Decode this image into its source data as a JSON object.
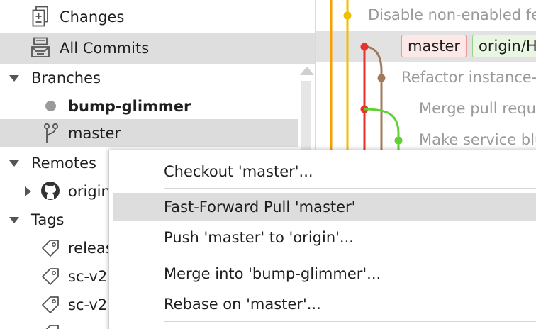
{
  "sidebar": {
    "workspace": [
      {
        "label": "Changes",
        "icon": "changes-icon"
      },
      {
        "label": "All Commits",
        "icon": "commits-icon",
        "selected": true
      }
    ],
    "branches": {
      "header": "Branches",
      "items": [
        {
          "label": "bump-glimmer",
          "icon": "current-branch-dot-icon",
          "current": true
        },
        {
          "label": "master",
          "icon": "branch-icon",
          "selected": true
        }
      ]
    },
    "remotes": {
      "header": "Remotes",
      "items": [
        {
          "label": "origin",
          "icon": "github-icon"
        }
      ]
    },
    "tags": {
      "header": "Tags",
      "items": [
        {
          "label": "releas",
          "icon": "tag-icon"
        },
        {
          "label": "sc-v2.",
          "icon": "tag-icon"
        },
        {
          "label": "sc-v2.",
          "icon": "tag-icon"
        },
        {
          "label": "",
          "icon": "tag-icon"
        }
      ]
    }
  },
  "graph": {
    "commits": [
      {
        "message": "Disable non-enabled fe"
      },
      {
        "message": "",
        "refs": [
          {
            "label": "master",
            "kind": "local"
          },
          {
            "label": "origin/H",
            "kind": "remote"
          }
        ]
      },
      {
        "message": "Refactor instance-"
      },
      {
        "message": "Merge pull requ"
      },
      {
        "message": "Make service blu"
      }
    ],
    "colors": {
      "lane_orange": "#f5a000",
      "lane_yellow": "#f0c000",
      "lane_red": "#e8322b",
      "lane_brown": "#a07a5a",
      "lane_green": "#5fd135"
    }
  },
  "context_menu": {
    "items": [
      {
        "label": "Checkout 'master'..."
      },
      {
        "label": "Fast-Forward Pull 'master'",
        "hover": true
      },
      {
        "label": "Push 'master' to 'origin'..."
      },
      {
        "label": "Merge into 'bump-glimmer'..."
      },
      {
        "label": "Rebase on 'master'..."
      }
    ]
  }
}
